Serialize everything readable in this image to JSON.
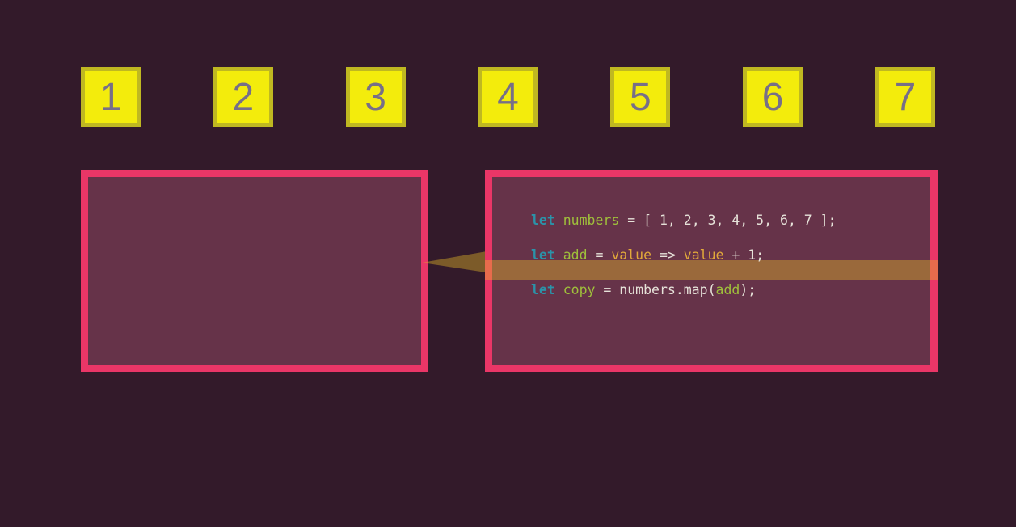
{
  "numbers": [
    "1",
    "2",
    "3",
    "4",
    "5",
    "6",
    "7"
  ],
  "code": {
    "line1": {
      "let": "let",
      "name": "numbers",
      "rest": " = [ 1, 2, 3, 4, 5, 6, 7 ];"
    },
    "line2": {
      "let": "let",
      "name": "add",
      "eq": " = ",
      "arg1": "value",
      "arrow": " => ",
      "arg2": "value",
      "rest": " + 1;"
    },
    "line3": {
      "let": "let",
      "name": "copy",
      "eq": " = numbers.map(",
      "func": "add",
      "rest": ");"
    }
  }
}
